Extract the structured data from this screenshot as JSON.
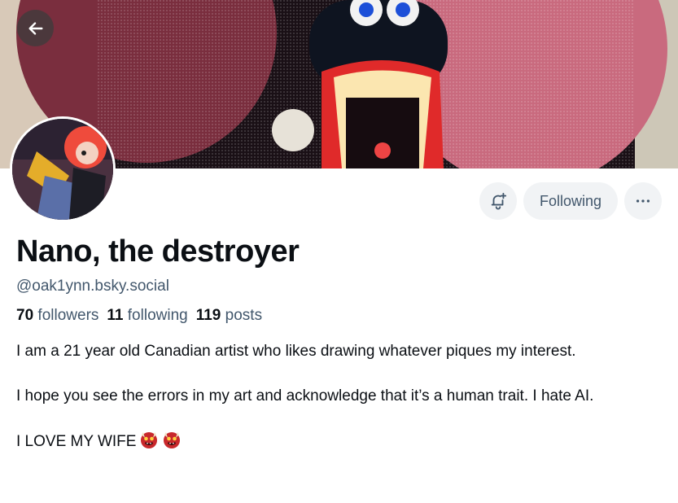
{
  "profile": {
    "display_name": "Nano, the destroyer",
    "handle": "@oak1ynn.bsky.social",
    "followers_count": "70",
    "followers_label": "followers",
    "following_count": "11",
    "following_label": "following",
    "posts_count": "119",
    "posts_label": "posts"
  },
  "actions": {
    "following_label": "Following",
    "subscribe_icon": "bell-plus-icon",
    "more_icon": "ellipsis-icon"
  },
  "nav": {
    "back_icon": "arrow-left-icon"
  },
  "bio": {
    "paragraph_1": "I am a 21 year old Canadian artist who likes drawing whatever piques my interest.",
    "paragraph_2": "I hope you see the errors in my art and acknowledge that it’s a human trait. I hate AI.",
    "paragraph_3": "I LOVE MY WIFE",
    "emoji": "ogre-emoji"
  },
  "colors": {
    "text_primary": "#0b0f14",
    "text_secondary": "#42576c",
    "button_bg": "#f1f3f5"
  }
}
